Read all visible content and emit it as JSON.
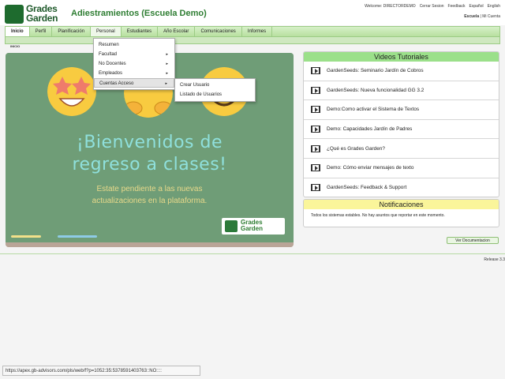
{
  "header": {
    "logo_line1": "Grades",
    "logo_line2": "Garden",
    "title": "Adiestramientos (Escuela Demo)",
    "welcome": "Welcome: DIRECTORDEMO",
    "logout": "Cerrar Sesion",
    "feedback": "Feedback",
    "lang_es": "Español",
    "lang_en": "English",
    "school": "Escuela",
    "separator": " | ",
    "my_account": "Mi Cuenta"
  },
  "nav": {
    "tabs": [
      {
        "label": "Inicio"
      },
      {
        "label": "Perfil"
      },
      {
        "label": "Planificación"
      },
      {
        "label": "Personal"
      },
      {
        "label": "Estudiantes"
      },
      {
        "label": "Año Escolar"
      },
      {
        "label": "Comunicaciones"
      },
      {
        "label": "Informes"
      }
    ],
    "breadcrumb": "INICIO"
  },
  "dropdown": {
    "items": [
      {
        "label": "Resumen"
      },
      {
        "label": "Facultad"
      },
      {
        "label": "No Docentes"
      },
      {
        "label": "Empleados"
      },
      {
        "label": "Cuentas Acceso"
      }
    ],
    "arrow": "▸",
    "submenu": [
      {
        "label": "Crear Usuario"
      },
      {
        "label": "Listado de Usuarios"
      }
    ]
  },
  "hero": {
    "line1": "¡Bienvenidos de",
    "line2": "regreso a clases!",
    "note1": "Estate pendiente a las nuevas",
    "note2": "actualizaciones en la plataforma.",
    "logo_line1": "Grades",
    "logo_line2": "Garden"
  },
  "videos": {
    "title": "Videos Tutoriales",
    "items": [
      {
        "label": "GardenSeeds: Seminario Jardín de Cobros"
      },
      {
        "label": "GardenSeeds: Nueva funcionalidad GG 3.2"
      },
      {
        "label": "Demo:Como activar el Sistema de Textos"
      },
      {
        "label": "Demo: Capacidades Jardín de Padres"
      },
      {
        "label": "¿Qué es Grades Garden?"
      },
      {
        "label": "Demo: Cómo enviar mensajes de texto"
      },
      {
        "label": "GardenSeeds: Feedback & Support"
      }
    ]
  },
  "notifications": {
    "title": "Notificaciones",
    "text": "Todos los sistemas estables. No hay asuntos que reportar en este momento."
  },
  "doc_button": "Ver Documentacion",
  "release": "Release 3.3",
  "status_url": "https://apex.gb-advisors.com/pls/web/f?p=1052:35:5378591403763::NO::::",
  "colors": {
    "brand_green": "#2e7d32",
    "nav_green": "#b8e0a0",
    "videos_header": "#9be08a",
    "notif_header": "#faf59a",
    "board": "#6f9d77"
  }
}
